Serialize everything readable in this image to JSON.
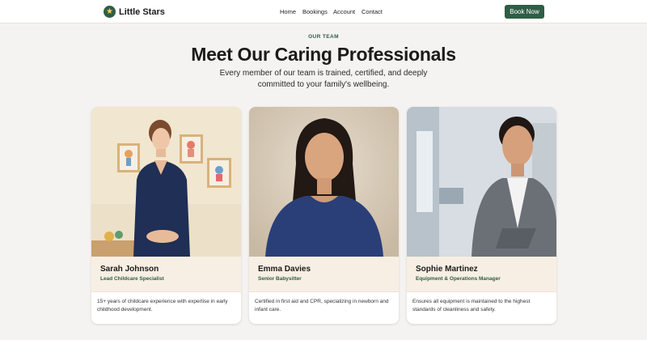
{
  "header": {
    "brand": "Little Stars",
    "logo_icon": "star-icon",
    "nav": [
      "Home",
      "Bookings",
      "Account",
      "Contact"
    ],
    "cta": "Book Now"
  },
  "hero": {
    "eyebrow": "OUR TEAM",
    "title": "Meet Our Caring Professionals",
    "subtitle": "Every member of our team is trained, certified, and deeply committed to your family's wellbeing."
  },
  "team": [
    {
      "name": "Sarah Johnson",
      "role": "Lead Childcare Specialist",
      "description": "15+ years of childcare experience with expertise in early childhood development."
    },
    {
      "name": "Emma Davies",
      "role": "Senior Babysitter",
      "description": "Certified in first aid and CPR, specializing in newborn and infant care."
    },
    {
      "name": "Sophie Martinez",
      "role": "Equipment & Operations Manager",
      "description": "Ensures all equipment is maintained to the highest standards of cleanliness and safety."
    }
  ],
  "colors": {
    "brand_green": "#2f5d45",
    "page_bg": "#f5f3f1",
    "info_bg": "#f7efe3"
  }
}
